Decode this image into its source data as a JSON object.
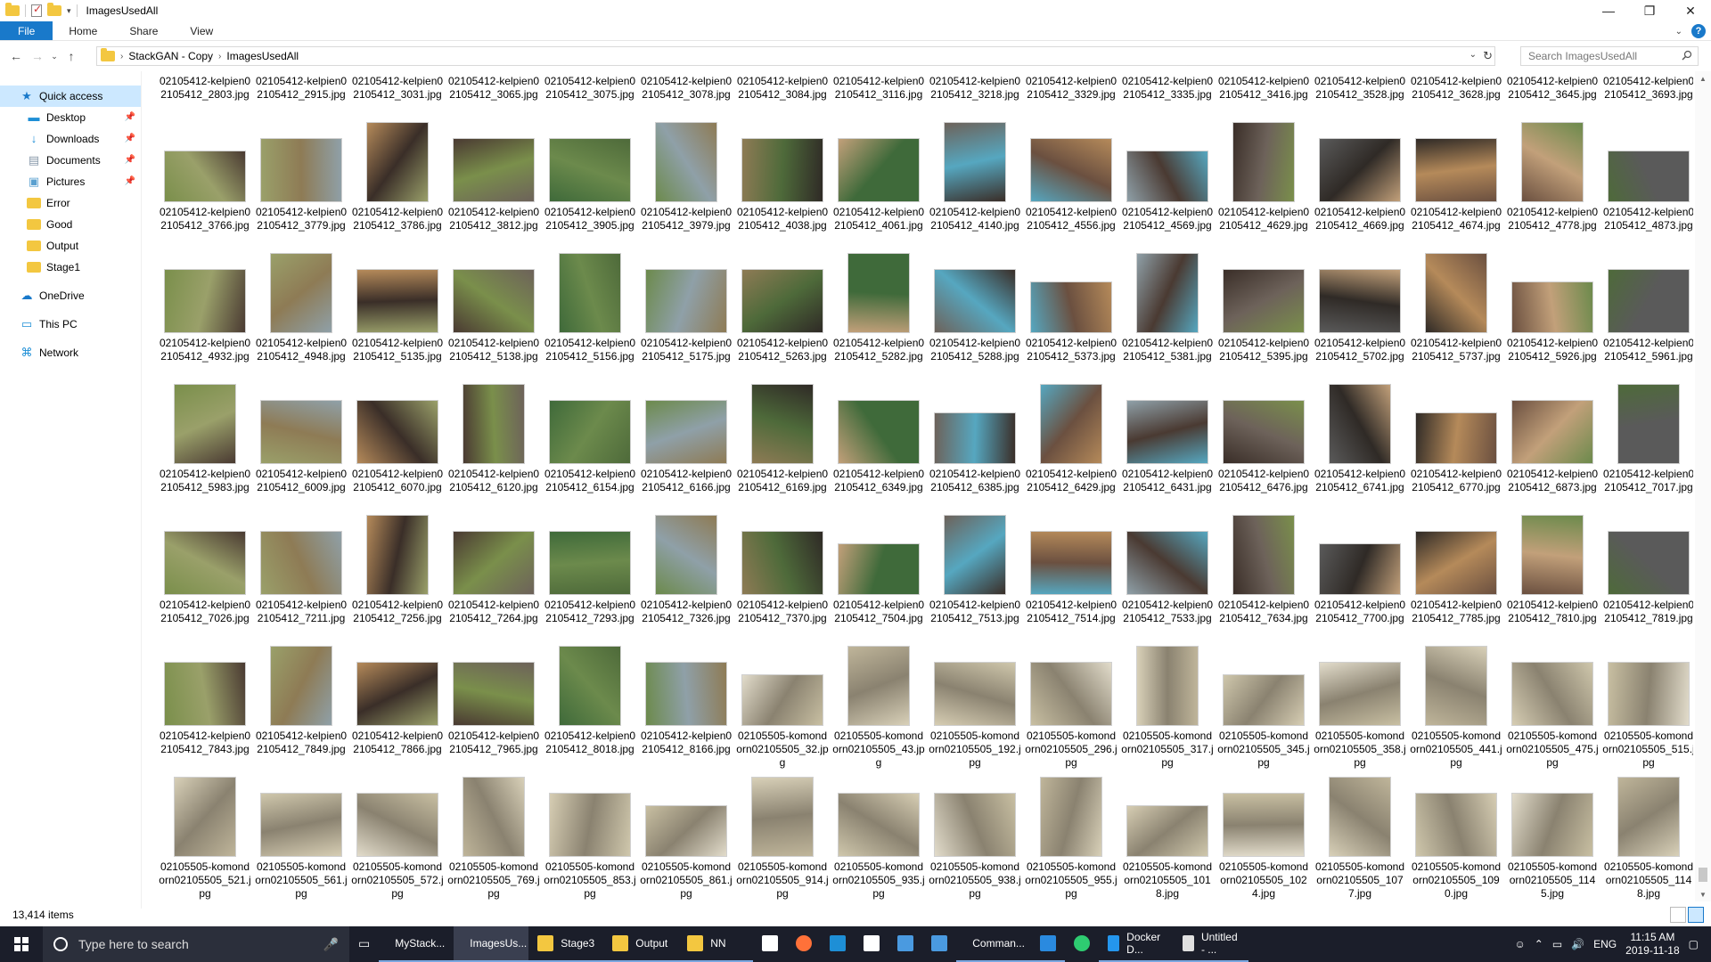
{
  "window": {
    "title": "ImagesUsedAll"
  },
  "ribbon": {
    "tabs": [
      "File",
      "Home",
      "Share",
      "View"
    ]
  },
  "address": {
    "crumbs": [
      "StackGAN - Copy",
      "ImagesUsedAll"
    ],
    "search_placeholder": "Search ImagesUsedAll"
  },
  "sidebar": {
    "items": [
      {
        "label": "Quick access",
        "icon": "star-icon",
        "pinned": false
      },
      {
        "label": "Desktop",
        "icon": "desktop-icon",
        "pinned": true
      },
      {
        "label": "Downloads",
        "icon": "download-icon",
        "pinned": true
      },
      {
        "label": "Documents",
        "icon": "documents-icon",
        "pinned": true
      },
      {
        "label": "Pictures",
        "icon": "pictures-icon",
        "pinned": true
      },
      {
        "label": "Error",
        "icon": "folder-icon",
        "pinned": false
      },
      {
        "label": "Good",
        "icon": "folder-icon",
        "pinned": false
      },
      {
        "label": "Output",
        "icon": "folder-icon",
        "pinned": false
      },
      {
        "label": "Stage1",
        "icon": "folder-icon",
        "pinned": false
      },
      {
        "label": "OneDrive",
        "icon": "cloud-icon",
        "pinned": false
      },
      {
        "label": "This PC",
        "icon": "computer-icon",
        "pinned": false
      },
      {
        "label": "Network",
        "icon": "network-icon",
        "pinned": false
      }
    ]
  },
  "files": [
    "02105412-kelpien02105412_2803.jpg",
    "02105412-kelpien02105412_2915.jpg",
    "02105412-kelpien02105412_3031.jpg",
    "02105412-kelpien02105412_3065.jpg",
    "02105412-kelpien02105412_3075.jpg",
    "02105412-kelpien02105412_3078.jpg",
    "02105412-kelpien02105412_3084.jpg",
    "02105412-kelpien02105412_3116.jpg",
    "02105412-kelpien02105412_3218.jpg",
    "02105412-kelpien02105412_3329.jpg",
    "02105412-kelpien02105412_3335.jpg",
    "02105412-kelpien02105412_3416.jpg",
    "02105412-kelpien02105412_3528.jpg",
    "02105412-kelpien02105412_3628.jpg",
    "02105412-kelpien02105412_3645.jpg",
    "02105412-kelpien02105412_3693.jpg",
    "02105412-kelpien02105412_3766.jpg",
    "02105412-kelpien02105412_3779.jpg",
    "02105412-kelpien02105412_3786.jpg",
    "02105412-kelpien02105412_3812.jpg",
    "02105412-kelpien02105412_3905.jpg",
    "02105412-kelpien02105412_3979.jpg",
    "02105412-kelpien02105412_4038.jpg",
    "02105412-kelpien02105412_4061.jpg",
    "02105412-kelpien02105412_4140.jpg",
    "02105412-kelpien02105412_4556.jpg",
    "02105412-kelpien02105412_4569.jpg",
    "02105412-kelpien02105412_4629.jpg",
    "02105412-kelpien02105412_4669.jpg",
    "02105412-kelpien02105412_4674.jpg",
    "02105412-kelpien02105412_4778.jpg",
    "02105412-kelpien02105412_4873.jpg",
    "02105412-kelpien02105412_4932.jpg",
    "02105412-kelpien02105412_4948.jpg",
    "02105412-kelpien02105412_5135.jpg",
    "02105412-kelpien02105412_5138.jpg",
    "02105412-kelpien02105412_5156.jpg",
    "02105412-kelpien02105412_5175.jpg",
    "02105412-kelpien02105412_5263.jpg",
    "02105412-kelpien02105412_5282.jpg",
    "02105412-kelpien02105412_5288.jpg",
    "02105412-kelpien02105412_5373.jpg",
    "02105412-kelpien02105412_5381.jpg",
    "02105412-kelpien02105412_5395.jpg",
    "02105412-kelpien02105412_5702.jpg",
    "02105412-kelpien02105412_5737.jpg",
    "02105412-kelpien02105412_5926.jpg",
    "02105412-kelpien02105412_5961.jpg",
    "02105412-kelpien02105412_5983.jpg",
    "02105412-kelpien02105412_6009.jpg",
    "02105412-kelpien02105412_6070.jpg",
    "02105412-kelpien02105412_6120.jpg",
    "02105412-kelpien02105412_6154.jpg",
    "02105412-kelpien02105412_6166.jpg",
    "02105412-kelpien02105412_6169.jpg",
    "02105412-kelpien02105412_6349.jpg",
    "02105412-kelpien02105412_6385.jpg",
    "02105412-kelpien02105412_6429.jpg",
    "02105412-kelpien02105412_6431.jpg",
    "02105412-kelpien02105412_6476.jpg",
    "02105412-kelpien02105412_6741.jpg",
    "02105412-kelpien02105412_6770.jpg",
    "02105412-kelpien02105412_6873.jpg",
    "02105412-kelpien02105412_7017.jpg",
    "02105412-kelpien02105412_7026.jpg",
    "02105412-kelpien02105412_7211.jpg",
    "02105412-kelpien02105412_7256.jpg",
    "02105412-kelpien02105412_7264.jpg",
    "02105412-kelpien02105412_7293.jpg",
    "02105412-kelpien02105412_7326.jpg",
    "02105412-kelpien02105412_7370.jpg",
    "02105412-kelpien02105412_7504.jpg",
    "02105412-kelpien02105412_7513.jpg",
    "02105412-kelpien02105412_7514.jpg",
    "02105412-kelpien02105412_7533.jpg",
    "02105412-kelpien02105412_7634.jpg",
    "02105412-kelpien02105412_7700.jpg",
    "02105412-kelpien02105412_7785.jpg",
    "02105412-kelpien02105412_7810.jpg",
    "02105412-kelpien02105412_7819.jpg",
    "02105412-kelpien02105412_7843.jpg",
    "02105412-kelpien02105412_7849.jpg",
    "02105412-kelpien02105412_7866.jpg",
    "02105412-kelpien02105412_7965.jpg",
    "02105412-kelpien02105412_8018.jpg",
    "02105412-kelpien02105412_8166.jpg",
    "02105505-komondorn02105505_32.jpg",
    "02105505-komondorn02105505_43.jpg",
    "02105505-komondorn02105505_192.jpg",
    "02105505-komondorn02105505_296.jpg",
    "02105505-komondorn02105505_317.jpg",
    "02105505-komondorn02105505_345.jpg",
    "02105505-komondorn02105505_358.jpg",
    "02105505-komondorn02105505_441.jpg",
    "02105505-komondorn02105505_475.jpg",
    "02105505-komondorn02105505_515.jpg",
    "02105505-komondorn02105505_521.jpg",
    "02105505-komondorn02105505_561.jpg",
    "02105505-komondorn02105505_572.jpg",
    "02105505-komondorn02105505_769.jpg",
    "02105505-komondorn02105505_853.jpg",
    "02105505-komondorn02105505_861.jpg",
    "02105505-komondorn02105505_914.jpg",
    "02105505-komondorn02105505_935.jpg",
    "02105505-komondorn02105505_938.jpg",
    "02105505-komondorn02105505_955.jpg",
    "02105505-komondorn02105505_1018.jpg",
    "02105505-komondorn02105505_1024.jpg",
    "02105505-komondorn02105505_1077.jpg",
    "02105505-komondorn02105505_1090.jpg",
    "02105505-komondorn02105505_1145.jpg",
    "02105505-komondorn02105505_1148.jpg"
  ],
  "status": {
    "item_count": "13,414 items"
  },
  "taskbar": {
    "search_placeholder": "Type here to search",
    "items": [
      {
        "label": "MyStack...",
        "icon": "edge-icon",
        "color": "#1e78d2",
        "state": "open"
      },
      {
        "label": "ImagesUs...",
        "icon": "folder-icon",
        "color": "#f3c740",
        "state": "active"
      },
      {
        "label": "Stage3",
        "icon": "folder-icon",
        "color": "#f3c740",
        "state": "open"
      },
      {
        "label": "Output",
        "icon": "folder-icon",
        "color": "#f3c740",
        "state": "open"
      },
      {
        "label": "NN",
        "icon": "folder-icon",
        "color": "#f3c740",
        "state": "open"
      },
      {
        "label": "",
        "icon": "store-icon",
        "color": "#ffffff",
        "state": ""
      },
      {
        "label": "",
        "icon": "firefox-icon",
        "color": "#ff7139",
        "state": ""
      },
      {
        "label": "",
        "icon": "pycharm-icon",
        "color": "#1e8fd6",
        "state": ""
      },
      {
        "label": "",
        "icon": "mail-icon",
        "color": "#ffffff",
        "state": ""
      },
      {
        "label": "",
        "icon": "app-icon",
        "color": "#4a9ae0",
        "state": ""
      },
      {
        "label": "",
        "icon": "window-icon",
        "color": "#4a9ae0",
        "state": ""
      },
      {
        "label": "Comman...",
        "icon": "terminal-icon",
        "color": "#333333",
        "state": "open"
      },
      {
        "label": "",
        "icon": "vscode-icon",
        "color": "#2a8adf",
        "state": "open"
      },
      {
        "label": "",
        "icon": "ring-icon",
        "color": "#2ecc71",
        "state": ""
      },
      {
        "label": "Docker D...",
        "icon": "docker-icon",
        "color": "#2496ed",
        "state": "open"
      },
      {
        "label": "Untitled - ...",
        "icon": "paint-icon",
        "color": "#e0e0e0",
        "state": "open"
      }
    ],
    "lang": "ENG",
    "time": "11:15 AM",
    "date": "2019-11-18"
  },
  "thumb_palette": [
    "#7a8f4b",
    "#9aa06a",
    "#b58a5a",
    "#4a3a32",
    "#3f6a3a",
    "#6c8a4c",
    "#8e7b55",
    "#c2a07a",
    "#6d625a",
    "#56a7c0",
    "#8fa0a8",
    "#3a2e28",
    "#5a5a5a",
    "#2f2a26",
    "#6b5040",
    "#4e6a3a"
  ],
  "komondor_palette": [
    "#d8d0b8",
    "#cfc7ac",
    "#e2dccb",
    "#bfb59a",
    "#d6cdb3",
    "#c8bfa2"
  ]
}
